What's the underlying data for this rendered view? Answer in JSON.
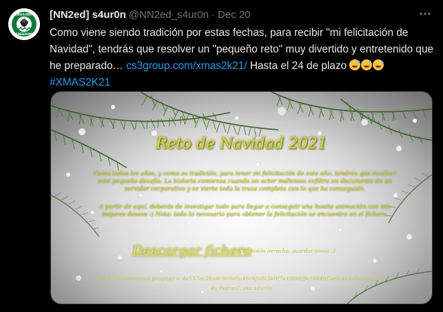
{
  "tweet": {
    "display_name": "[NN2ed] s4ur0n",
    "handle": "@NN2ed_s4ur0n",
    "separator": "·",
    "date": "Dec 20",
    "more_icon": "more-horizontal-icon",
    "avatar_icon": "gnu-linux-freedom-logo",
    "avatar_text": "GNU/LINUX FREEDOM",
    "text_main": "Como viene siendo tradición por estas fechas, para recibir \"mi felicitación de Navidad\", tendrás que resolver un \"pequeño reto\" muy divertido y entretenido que he preparado… ",
    "link": "cs3group.com/xmas2k21/",
    "text_after_link": " Hasta el 24 de plazo ",
    "hashtag": "#XMAS2K21"
  },
  "card": {
    "title": "Reto de Navidad 2021",
    "paragraph1": "Como todos los años, y como es tradición, para tener mi felicitación de este año, tendrás que resolver este pequeño desafío. La historia comienza cuando un actor malicioso exfiltra un documento de un servidor corporativo y se vierte toda la traza completa con lo que ha conseguido.",
    "paragraph2": "A partir de aquí, deberás de investigar todo para llegar a conseguir una bonita animación con mis mejores deseos :) Nota: todo lo necesario para obtener la felicitación se encuentra en el fichero.",
    "download_label": "Descargar fichero",
    "download_note": "(Clic botón derecho, guardar como...)",
    "hash_line": "SHA256(download.pcapng) = 4e557ac26adc9d8e0a46cbfd8c2e0f7e1f8b6ffe16b4bf5e0c4c1a9a0e6ccc2",
    "byline": "By Pedro C. aka s4ur0n"
  },
  "colors": {
    "background": "#000000",
    "text": "#e7e9ea",
    "muted": "#71767b",
    "link": "#1d9bf0",
    "card_text": "#e6d23a"
  }
}
